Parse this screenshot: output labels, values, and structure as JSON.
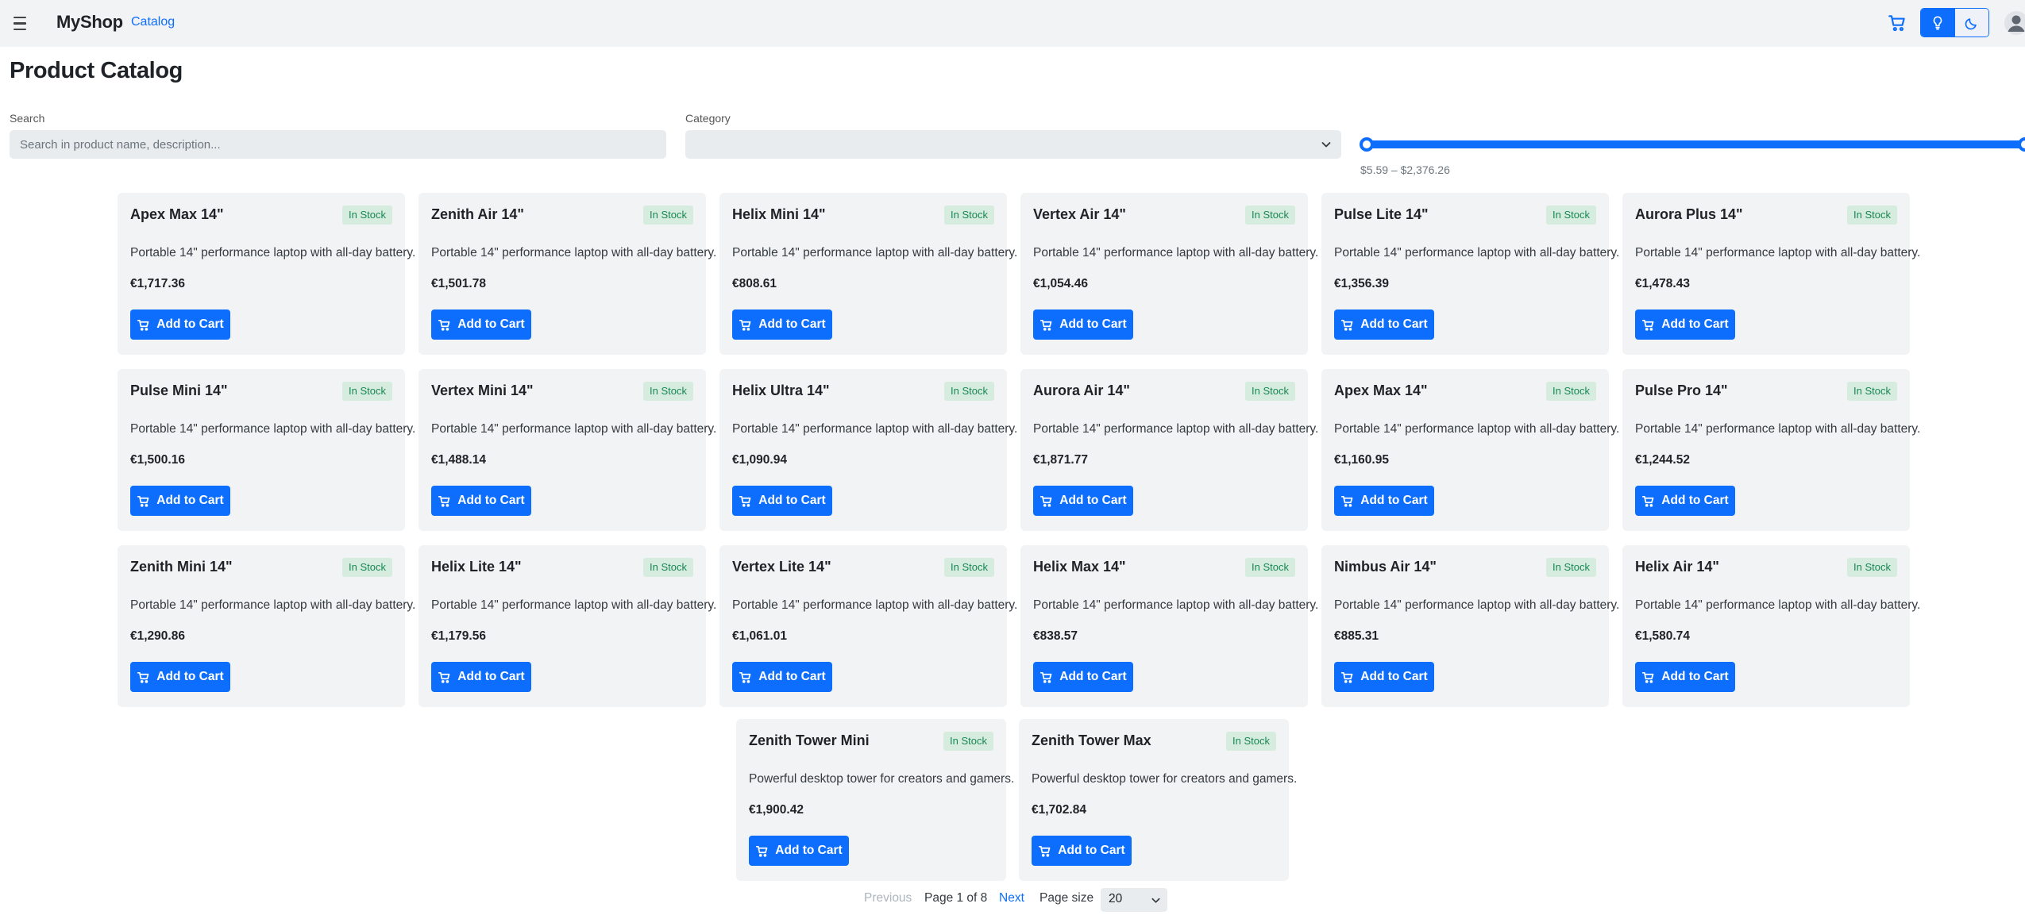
{
  "header": {
    "brand": "MyShop",
    "nav_link": "Catalog"
  },
  "page": {
    "title": "Product Catalog"
  },
  "filters": {
    "search_label": "Search",
    "search_placeholder": "Search in product name, description...",
    "search_value": "",
    "category_label": "Category",
    "category_value": "",
    "price_range_text": "$5.59 – $2,376.26",
    "price_min": 5.59,
    "price_max": 2376.26
  },
  "products": [
    {
      "name": "Apex Max 14\"",
      "stock": "In Stock",
      "description": "Portable 14\" performance laptop with all-day battery.",
      "price": "€1,717.36",
      "button": "Add to Cart"
    },
    {
      "name": "Zenith Air 14\"",
      "stock": "In Stock",
      "description": "Portable 14\" performance laptop with all-day battery.",
      "price": "€1,501.78",
      "button": "Add to Cart"
    },
    {
      "name": "Helix Mini 14\"",
      "stock": "In Stock",
      "description": "Portable 14\" performance laptop with all-day battery.",
      "price": "€808.61",
      "button": "Add to Cart"
    },
    {
      "name": "Vertex Air 14\"",
      "stock": "In Stock",
      "description": "Portable 14\" performance laptop with all-day battery.",
      "price": "€1,054.46",
      "button": "Add to Cart"
    },
    {
      "name": "Pulse Lite 14\"",
      "stock": "In Stock",
      "description": "Portable 14\" performance laptop with all-day battery.",
      "price": "€1,356.39",
      "button": "Add to Cart"
    },
    {
      "name": "Aurora Plus 14\"",
      "stock": "In Stock",
      "description": "Portable 14\" performance laptop with all-day battery.",
      "price": "€1,478.43",
      "button": "Add to Cart"
    },
    {
      "name": "Pulse Mini 14\"",
      "stock": "In Stock",
      "description": "Portable 14\" performance laptop with all-day battery.",
      "price": "€1,500.16",
      "button": "Add to Cart"
    },
    {
      "name": "Vertex Mini 14\"",
      "stock": "In Stock",
      "description": "Portable 14\" performance laptop with all-day battery.",
      "price": "€1,488.14",
      "button": "Add to Cart"
    },
    {
      "name": "Helix Ultra 14\"",
      "stock": "In Stock",
      "description": "Portable 14\" performance laptop with all-day battery.",
      "price": "€1,090.94",
      "button": "Add to Cart"
    },
    {
      "name": "Aurora Air 14\"",
      "stock": "In Stock",
      "description": "Portable 14\" performance laptop with all-day battery.",
      "price": "€1,871.77",
      "button": "Add to Cart"
    },
    {
      "name": "Apex Max 14\"",
      "stock": "In Stock",
      "description": "Portable 14\" performance laptop with all-day battery.",
      "price": "€1,160.95",
      "button": "Add to Cart"
    },
    {
      "name": "Pulse Pro 14\"",
      "stock": "In Stock",
      "description": "Portable 14\" performance laptop with all-day battery.",
      "price": "€1,244.52",
      "button": "Add to Cart"
    },
    {
      "name": "Zenith Mini 14\"",
      "stock": "In Stock",
      "description": "Portable 14\" performance laptop with all-day battery.",
      "price": "€1,290.86",
      "button": "Add to Cart"
    },
    {
      "name": "Helix Lite 14\"",
      "stock": "In Stock",
      "description": "Portable 14\" performance laptop with all-day battery.",
      "price": "€1,179.56",
      "button": "Add to Cart"
    },
    {
      "name": "Vertex Lite 14\"",
      "stock": "In Stock",
      "description": "Portable 14\" performance laptop with all-day battery.",
      "price": "€1,061.01",
      "button": "Add to Cart"
    },
    {
      "name": "Helix Max 14\"",
      "stock": "In Stock",
      "description": "Portable 14\" performance laptop with all-day battery.",
      "price": "€838.57",
      "button": "Add to Cart"
    },
    {
      "name": "Nimbus Air 14\"",
      "stock": "In Stock",
      "description": "Portable 14\" performance laptop with all-day battery.",
      "price": "€885.31",
      "button": "Add to Cart"
    },
    {
      "name": "Helix Air 14\"",
      "stock": "In Stock",
      "description": "Portable 14\" performance laptop with all-day battery.",
      "price": "€1,580.74",
      "button": "Add to Cart"
    },
    {
      "name": "Zenith Tower Mini",
      "stock": "In Stock",
      "description": "Powerful desktop tower for creators and gamers.",
      "price": "€1,900.42",
      "button": "Add to Cart"
    },
    {
      "name": "Zenith Tower Max",
      "stock": "In Stock",
      "description": "Powerful desktop tower for creators and gamers.",
      "price": "€1,702.84",
      "button": "Add to Cart"
    }
  ],
  "pagination": {
    "previous": "Previous",
    "info": "Page 1 of 8",
    "next": "Next",
    "page_size_label": "Page size",
    "page_size_value": "20"
  },
  "icons": {
    "menu": "hamburger-menu-icon",
    "cart": "cart-icon",
    "light_theme": "lightbulb-icon",
    "dark_theme": "moon-icon",
    "account": "user-avatar-icon",
    "select_chevron": "chevron-down-icon"
  },
  "colors": {
    "primary": "#0d6efd",
    "stock_badge_bg": "#d6ecdf",
    "stock_badge_text": "#198754",
    "card_bg": "#f1f3f5"
  }
}
